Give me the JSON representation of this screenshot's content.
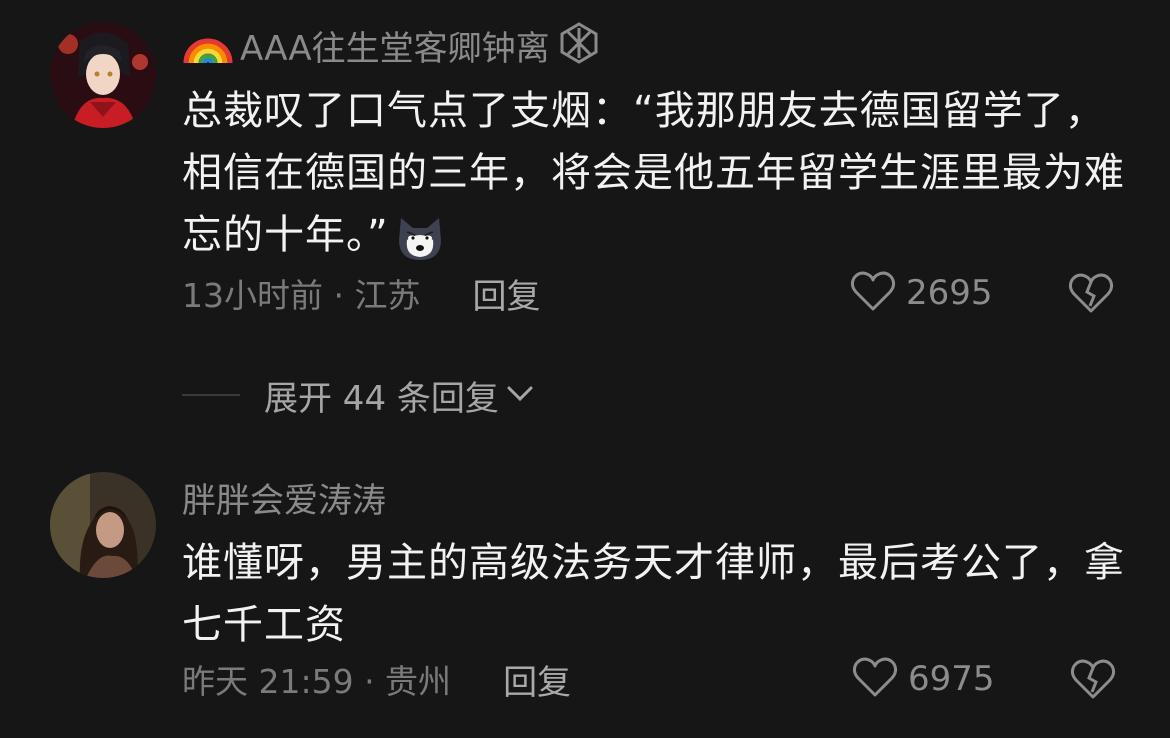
{
  "comments": [
    {
      "username": "AAA往生堂客卿钟离",
      "text": "总裁叹了口气点了支烟：“我那朋友去德国留学了，相信在德国的三年，将会是他五年留学生涯里最为难忘的十年。”",
      "emoji": "husky-emoji",
      "time_location": "13小时前 · 江苏",
      "reply_label": "回复",
      "likes": "2695"
    },
    {
      "username": "胖胖会爱涛涛",
      "text": "谁懂呀，男主的高级法务天才律师，最后考公了，拿七千工资",
      "time_location": "昨天 21:59 · 贵州",
      "reply_label": "回复",
      "likes": "6975"
    }
  ],
  "expand_replies": "展开 44 条回复",
  "icons": {
    "badge_left": "rainbow-icon",
    "badge_right": "badge-icon",
    "like": "heart-outline-icon",
    "dislike": "broken-heart-icon",
    "expand": "chevron-down-icon"
  },
  "colors": {
    "background": "#161616",
    "text": "#f2f2f2",
    "muted": "#8a8a8a"
  }
}
